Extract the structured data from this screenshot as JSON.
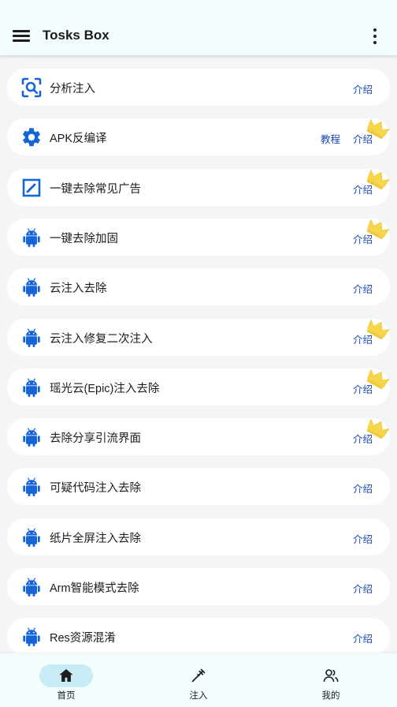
{
  "app_bar": {
    "title": "Tosks Box"
  },
  "colors": {
    "accent_blue": "#1565d8",
    "link_blue": "#1a48b3",
    "crown_yellow": "#f6d64a",
    "active_pill": "#c7ecf6"
  },
  "items": [
    {
      "label": "分析注入",
      "icon": "scan-search-icon",
      "intro": "介绍",
      "tutorial": null,
      "crown": false
    },
    {
      "label": "APK反编译",
      "icon": "gear-icon",
      "intro": "介绍",
      "tutorial": "教程",
      "crown": true
    },
    {
      "label": "一键去除常见广告",
      "icon": "edit-box-icon",
      "intro": "介绍",
      "tutorial": null,
      "crown": true
    },
    {
      "label": "一键去除加固",
      "icon": "android-icon",
      "intro": "介绍",
      "tutorial": null,
      "crown": true
    },
    {
      "label": "云注入去除",
      "icon": "android-icon",
      "intro": "介绍",
      "tutorial": null,
      "crown": false
    },
    {
      "label": "云注入修复二次注入",
      "icon": "android-icon",
      "intro": "介绍",
      "tutorial": null,
      "crown": true
    },
    {
      "label": "瑶光云(Epic)注入去除",
      "icon": "android-icon",
      "intro": "介绍",
      "tutorial": null,
      "crown": true
    },
    {
      "label": "去除分享引流界面",
      "icon": "android-icon",
      "intro": "介绍",
      "tutorial": null,
      "crown": true
    },
    {
      "label": "可疑代码注入去除",
      "icon": "android-icon",
      "intro": "介绍",
      "tutorial": null,
      "crown": false
    },
    {
      "label": "纸片全屏注入去除",
      "icon": "android-icon",
      "intro": "介绍",
      "tutorial": null,
      "crown": false
    },
    {
      "label": "Arm智能模式去除",
      "icon": "android-icon",
      "intro": "介绍",
      "tutorial": null,
      "crown": false
    },
    {
      "label": "Res资源混淆",
      "icon": "android-icon",
      "intro": "介绍",
      "tutorial": null,
      "crown": false
    }
  ],
  "bottom_nav": [
    {
      "label": "首页",
      "icon": "home-icon",
      "active": true
    },
    {
      "label": "注入",
      "icon": "syringe-icon",
      "active": false
    },
    {
      "label": "我的",
      "icon": "people-icon",
      "active": false
    }
  ]
}
